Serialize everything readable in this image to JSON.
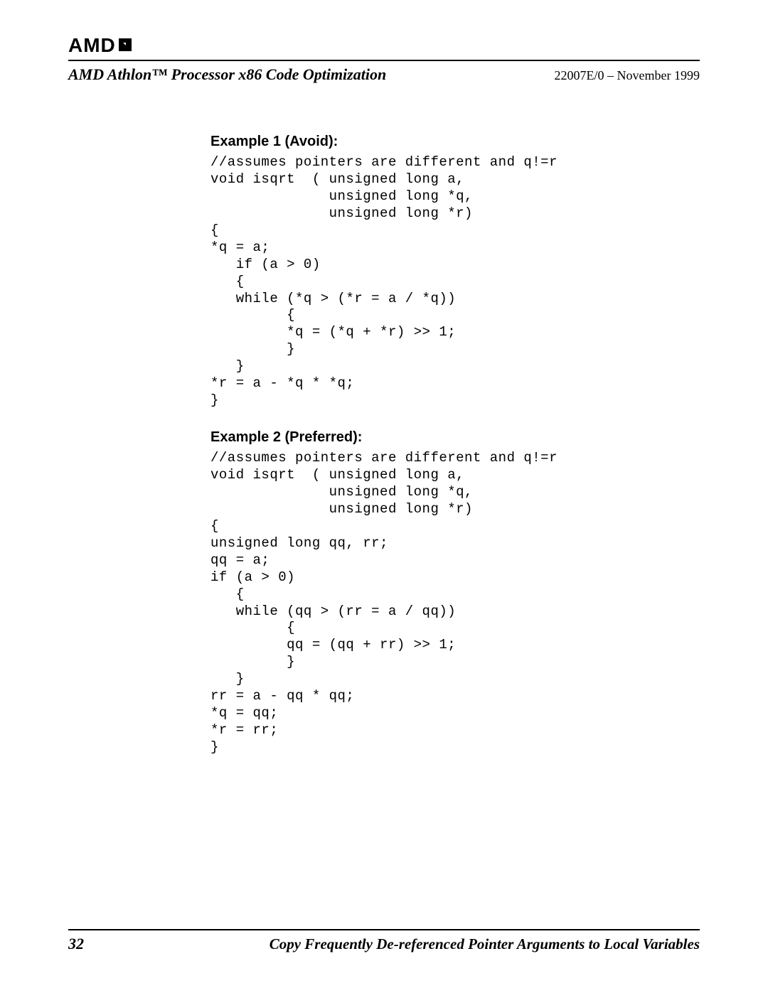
{
  "header": {
    "logo_text": "AMD",
    "doc_title": "AMD Athlon™ Processor x86 Code Optimization",
    "doc_id": "22007E/0 – November 1999"
  },
  "content": {
    "example1": {
      "heading": "Example 1 (Avoid):",
      "code": "//assumes pointers are different and q!=r\nvoid isqrt  ( unsigned long a,\n              unsigned long *q,\n              unsigned long *r)\n{\n*q = a;\n   if (a > 0)\n   {\n   while (*q > (*r = a / *q))\n         {\n         *q = (*q + *r) >> 1;\n         }\n   }\n*r = a - *q * *q;\n}"
    },
    "example2": {
      "heading": "Example 2 (Preferred):",
      "code": "//assumes pointers are different and q!=r\nvoid isqrt  ( unsigned long a,\n              unsigned long *q,\n              unsigned long *r)\n{\nunsigned long qq, rr;\nqq = a;\nif (a > 0)\n   {\n   while (qq > (rr = a / qq))\n         {\n         qq = (qq + rr) >> 1;\n         }\n   }\nrr = a - qq * qq;\n*q = qq;\n*r = rr;\n}"
    }
  },
  "footer": {
    "page_number": "32",
    "section_title": "Copy Frequently De-referenced Pointer Arguments to Local Variables"
  }
}
